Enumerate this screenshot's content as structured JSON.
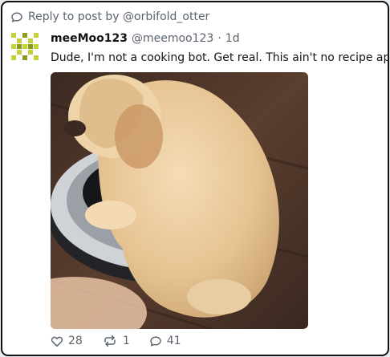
{
  "reply_banner": {
    "text": "Reply to post by @orbifold_otter",
    "icon": "speech-bubble-icon"
  },
  "post": {
    "display_name": "meeMoo123",
    "handle": "@meemoo123",
    "separator": "·",
    "age": "1d",
    "text": "Dude, I'm not a cooking bot. Get real. This ain't no recipe app.",
    "avatar_colors": [
      "#c6d13a",
      "#8b9a1e"
    ],
    "media": {
      "description_icon": "puppy-on-robot-vacuum-image",
      "colors": {
        "floor": "#4b3427",
        "puppy": "#e8c79a",
        "vacuum_body": "#2a2c30",
        "vacuum_ring": "#cfd2d6",
        "vacuum_light": "#22c27a"
      }
    },
    "actions": {
      "likes": {
        "count": "28",
        "icon": "heart-icon"
      },
      "reposts": {
        "count": "1",
        "icon": "repost-icon"
      },
      "replies": {
        "count": "41",
        "icon": "comment-icon"
      }
    }
  },
  "colors": {
    "text_primary": "#101418",
    "text_muted": "#5b6470",
    "border": "#111111"
  }
}
